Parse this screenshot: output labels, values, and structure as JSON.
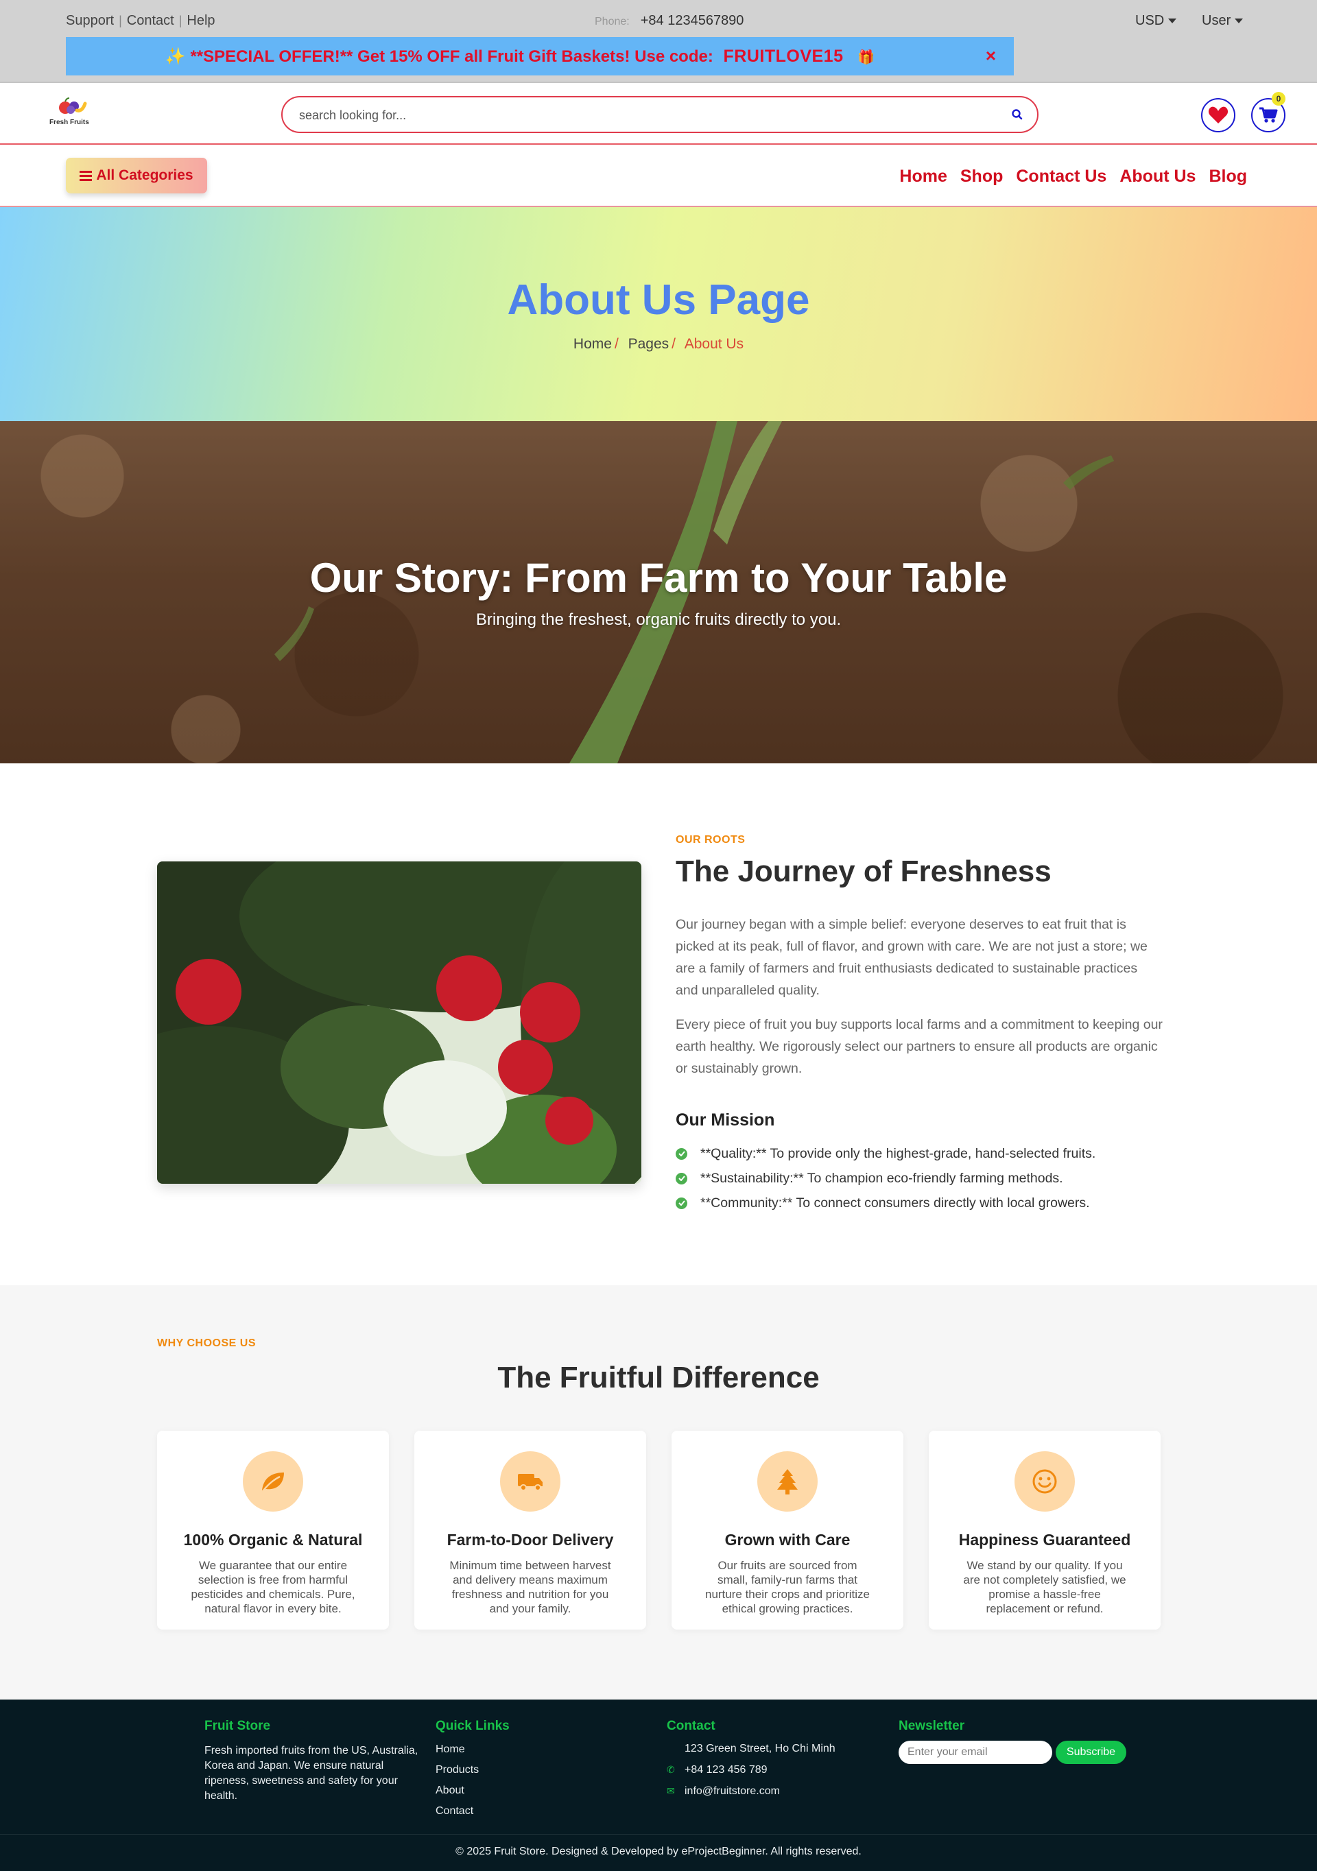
{
  "topbar": {
    "links": [
      "Support",
      "Contact",
      "Help"
    ],
    "phone_label": "Phone:",
    "phone": "+84 1234567890",
    "currency": "USD",
    "user": "User"
  },
  "promo": {
    "text": "✨ **SPECIAL OFFER!** Get 15% OFF all Fruit Gift Baskets! Use code:",
    "code": "FRUITLOVE15",
    "gift": "🎁",
    "close": "×"
  },
  "header": {
    "logo_text": "Fresh Fruits",
    "search_placeholder": "search looking for...",
    "cart_count": "0"
  },
  "nav": {
    "all_categories": "All Categories",
    "links": [
      "Home",
      "Shop",
      "Contact Us",
      "About Us",
      "Blog"
    ]
  },
  "page_banner": {
    "title": "About Us Page",
    "breadcrumb": [
      "Home",
      "Pages",
      "About Us"
    ]
  },
  "hero": {
    "title": "Our Story: From Farm to Your Table",
    "subtitle": "Bringing the freshest, organic fruits directly to you."
  },
  "story": {
    "eyebrow": "OUR ROOTS",
    "title": "The Journey of Freshness",
    "paragraphs": [
      "Our journey began with a simple belief: everyone deserves to eat fruit that is picked at its peak, full of flavor, and grown with care. We are not just a store; we are a family of farmers and fruit enthusiasts dedicated to sustainable practices and unparalleled quality.",
      "Every piece of fruit you buy supports local farms and a commitment to keeping our earth healthy. We rigorously select our partners to ensure all products are organic or sustainably grown."
    ],
    "mission_title": "Our Mission",
    "mission": [
      "**Quality:** To provide only the highest-grade, hand-selected fruits.",
      "**Sustainability:** To champion eco-friendly farming methods.",
      "**Community:** To connect consumers directly with local growers."
    ]
  },
  "why": {
    "eyebrow": "WHY CHOOSE US",
    "title": "The Fruitful Difference",
    "cards": [
      {
        "icon": "leaf-icon",
        "title": "100% Organic & Natural",
        "desc": "We guarantee that our entire selection is free from harmful pesticides and chemicals. Pure, natural flavor in every bite."
      },
      {
        "icon": "truck-icon",
        "title": "Farm-to-Door Delivery",
        "desc": "Minimum time between harvest and delivery means maximum freshness and nutrition for you and your family."
      },
      {
        "icon": "tree-icon",
        "title": "Grown with Care",
        "desc": "Our fruits are sourced from small, family-run farms that nurture their crops and prioritize ethical growing practices."
      },
      {
        "icon": "smile-icon",
        "title": "Happiness Guaranteed",
        "desc": "We stand by our quality. If you are not completely satisfied, we promise a hassle-free replacement or refund."
      }
    ]
  },
  "footer": {
    "about_title": "Fruit Store",
    "about_text": "Fresh imported fruits from the US, Australia, Korea and Japan. We ensure natural ripeness, sweetness and safety for your health.",
    "links_title": "Quick Links",
    "links": [
      "Home",
      "Products",
      "About",
      "Contact"
    ],
    "contact_title": "Contact",
    "address": "123 Green Street, Ho Chi Minh",
    "phone": "+84 123 456 789",
    "email": "info@fruitstore.com",
    "newsletter_title": "Newsletter",
    "newsletter_placeholder": "Enter your email",
    "subscribe": "Subscribe",
    "copyright": "© 2025 Fruit Store. Designed & Developed by eProjectBeginner. All rights reserved."
  },
  "colors": {
    "accent_red": "#d10f20",
    "accent_orange": "#f08a10",
    "footer_green": "#18c24a",
    "heading_blue": "#4f82ea"
  }
}
